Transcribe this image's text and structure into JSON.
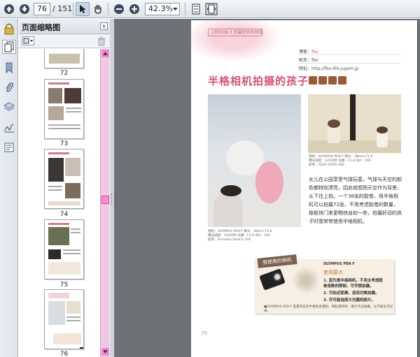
{
  "toolbar": {
    "page_current": "76",
    "page_total": "/ 151",
    "zoom": "42.3%"
  },
  "panel": {
    "title": "页面缩略图",
    "close": "x"
  },
  "thumbnails": [
    {
      "label": "72"
    },
    {
      "label": "73"
    },
    {
      "label": "74"
    },
    {
      "label": "75"
    },
    {
      "label": "76"
    }
  ],
  "document": {
    "header_tag": "LESSON 3  在最优中的拍摄",
    "meta": [
      {
        "key": "博客：",
        "value": "fbo",
        "accent": true
      },
      {
        "key": "昵名：",
        "value": "fbo",
        "accent": false
      },
      {
        "key": "网址：",
        "value": "http://fbo-life.jugem.jp",
        "accent": false
      }
    ],
    "title": "半格相机拍摄的孩子",
    "caption_right": [
      "相机：OLYMPUS PEN F  镜头：38mm F1.8",
      "曝光速度：1/250秒  光圈：F1.8  ISO：100",
      "胶卷：AGFA VISTA 400"
    ],
    "caption_left": [
      "相机：OLYMPUS PEN F  镜头：38mm F1.8",
      "曝光速度：1/250秒  光圈：F1.8  ISO：100",
      "胶卷：Fomanto Solarix 100"
    ],
    "body": "女儿在公园享受气球玩耍，气球与天空的颜色都特别漂亮，因此就想把天空作为背景，从下往上拍。一个36张的胶卷，用半格相机可以拍摄72张，不用考虑胶卷的数量，按板快门来更畅快自如一些，拍摄好动的孩子时我常常使用半格相机。",
    "box_label": "我使用的相机",
    "box_head": "OLYMPUS PEN F",
    "box_sub": "使用要点",
    "box_items": [
      "1. 因为是半格相机，不用太考虑胶",
      "   卷张数的限制，可尽情拍摄。",
      "2. 可拍近距离，适用对焦拍摄。",
      "3. 尽可能选择大光圈的胶片。"
    ],
    "box_note": "●OLYMPUS PEN F 是最有名的半格单反相机，用起来简单，便于外出拍摄，以丰富生活记录。",
    "page_number": "70"
  }
}
